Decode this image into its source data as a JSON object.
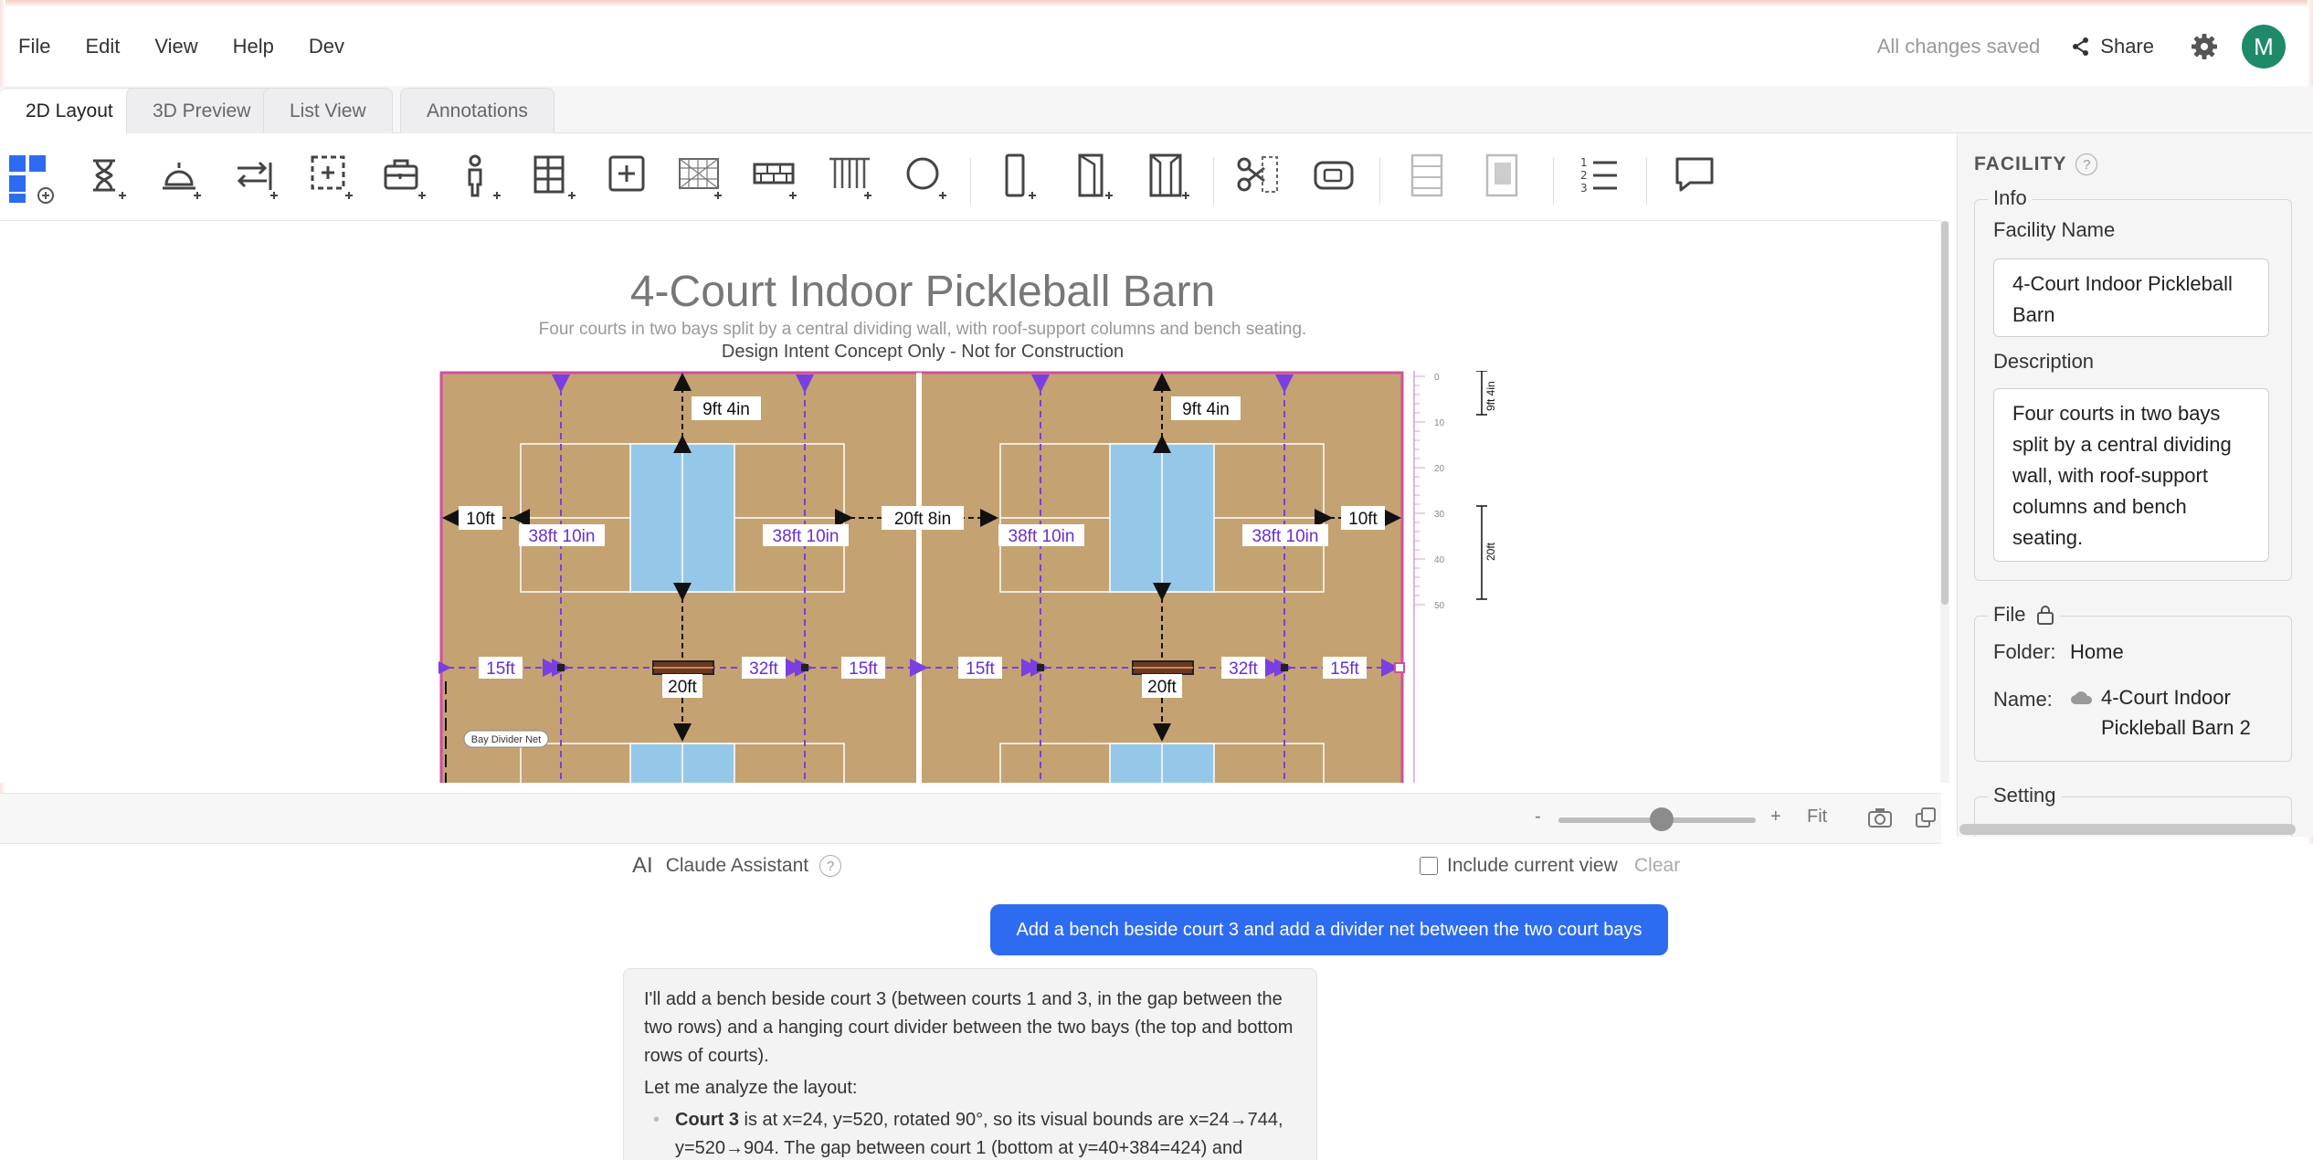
{
  "menu": {
    "items": [
      "File",
      "Edit",
      "View",
      "Help",
      "Dev"
    ]
  },
  "header": {
    "save_status": "All changes saved",
    "share_label": "Share",
    "avatar_initial": "M"
  },
  "tabs": [
    {
      "label": "2D Layout",
      "active": true
    },
    {
      "label": "3D Preview",
      "active": false
    },
    {
      "label": "List View",
      "active": false
    },
    {
      "label": "Annotations",
      "active": false
    }
  ],
  "toolbar": {
    "tools": [
      "add-court-icon",
      "add-timer-icon",
      "add-bell-icon",
      "add-divider-icon",
      "add-region-icon",
      "add-equipment-icon",
      "add-person-icon",
      "add-shelf-icon",
      "add-box-icon",
      "add-net-icon",
      "add-wall-icon",
      "add-curtain-icon",
      "add-column-icon",
      "add-door-icon",
      "add-swing-door-icon",
      "add-double-door-icon",
      "cut-icon",
      "capture-icon",
      "panel-icon",
      "panel-alt-icon",
      "numbered-list-icon",
      "comment-icon"
    ]
  },
  "plan": {
    "title": "4-Court Indoor Pickleball Barn",
    "subtitle": "Four courts in two bays split by a central dividing wall, with roof-support columns and bench seating.",
    "note": "Design Intent Concept Only - Not for Construction",
    "dims": {
      "top_left": "9ft 4in",
      "top_right": "9ft 4in",
      "left_wall": "10ft",
      "right_wall": "10ft",
      "between": "20ft 8in",
      "court_len_1": "38ft 10in",
      "court_len_2": "38ft 10in",
      "court_len_3": "38ft 10in",
      "court_len_4": "38ft 10in",
      "row_a": "15ft",
      "row_b": "32ft",
      "row_c": "15ft",
      "row_d": "15ft",
      "row_e": "32ft",
      "row_f": "15ft",
      "gap_left": "20ft",
      "gap_right": "20ft",
      "ruler_top": "9ft 4in",
      "ruler_mid": "20ft"
    },
    "net_label": "Bay Divider Net",
    "ruler_ticks": [
      "0",
      "10",
      "20",
      "30",
      "40",
      "50"
    ]
  },
  "zoom": {
    "minus": "-",
    "plus": "+",
    "fit": "Fit"
  },
  "panel": {
    "heading": "FACILITY",
    "help": "?",
    "info": {
      "legend": "Info",
      "name_label": "Facility Name",
      "name_value": "4-Court Indoor Pickleball Barn",
      "desc_label": "Description",
      "desc_value": "Four courts in two bays split by a central dividing wall, with roof-support columns and bench seating."
    },
    "file": {
      "legend": "File",
      "folder_label": "Folder:",
      "folder_value": "Home",
      "name_label": "Name:",
      "name_value": "4-Court Indoor Pickleball Barn 2"
    },
    "setting": {
      "legend": "Setting"
    }
  },
  "chat": {
    "ai_icon": "AI",
    "assistant_label": "Claude Assistant",
    "help": "?",
    "include_view": "Include current view",
    "clear": "Clear",
    "user_message": "Add a bench beside court 3 and add a divider net between the two court bays",
    "reply_p1": "I'll add a bench beside court 3 (between courts 1 and 3, in the gap between the two rows) and a hanging court divider between the two bays (the top and bottom rows of courts).",
    "reply_p2": "Let me analyze the layout:",
    "reply_li_bold": "Court 3",
    "reply_li_text": " is at x=24, y=520, rotated 90°, so its visual bounds are x=24→744, y=520→904. The gap between court 1 (bottom at y=40+384=424) and"
  },
  "colors": {
    "accent": "#2d6cf0",
    "floor": "#c4a272",
    "court_blue": "#95c8e8",
    "dim_purple": "#7a3fe0",
    "boundary": "#d14fa0"
  }
}
